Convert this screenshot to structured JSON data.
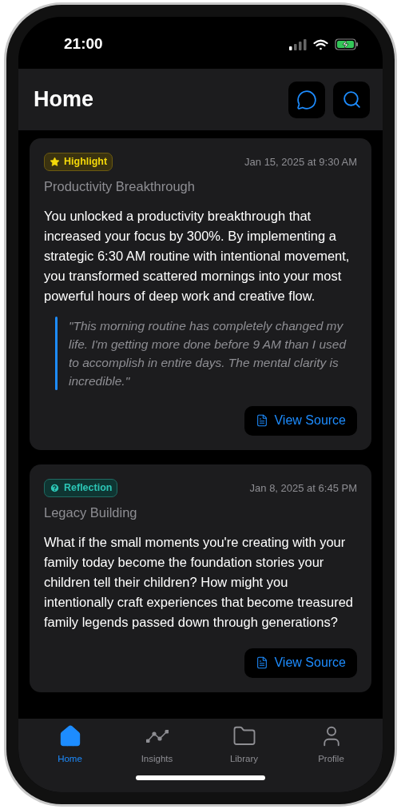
{
  "status_bar": {
    "time": "21:00"
  },
  "header": {
    "title": "Home"
  },
  "cards": [
    {
      "kind": "highlight",
      "badge": "Highlight",
      "date": "Jan 15, 2025 at 9:30 AM",
      "title": "Productivity Breakthrough",
      "body": "You unlocked a productivity breakthrough that increased your focus by 300%. By implementing a strategic 6:30 AM routine with intentional movement, you transformed scattered mornings into your most powerful hours of deep work and creative flow.",
      "quote": "\"This morning routine has completely changed my life. I'm getting more done before 9 AM than I used to accomplish in entire days. The mental clarity is incredible.\"",
      "button": "View Source"
    },
    {
      "kind": "reflection",
      "badge": "Reflection",
      "date": "Jan 8, 2025 at 6:45 PM",
      "title": "Legacy Building",
      "body": "What if the small moments you're creating with your family today become the foundation stories your children tell their children? How might you intentionally craft experiences that become treasured family legends passed down through generations?",
      "button": "View Source"
    }
  ],
  "tab_bar": [
    {
      "label": "Home",
      "selected": true
    },
    {
      "label": "Insights",
      "selected": false
    },
    {
      "label": "Library",
      "selected": false
    },
    {
      "label": "Profile",
      "selected": false
    }
  ]
}
